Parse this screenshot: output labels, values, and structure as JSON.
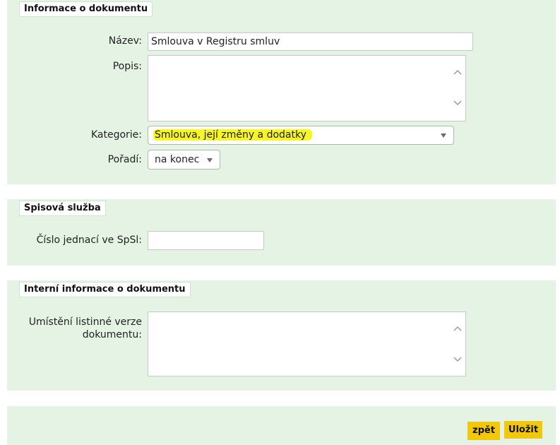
{
  "sections": {
    "document_info": {
      "title": "Informace o dokumentu",
      "name_label": "Název:",
      "name_value": "Smlouva v Registru smluv",
      "description_label": "Popis:",
      "description_value": "",
      "category_label": "Kategorie:",
      "category_value": "Smlouva, její změny a dodatky",
      "order_label": "Pořadí:",
      "order_value": "na konec"
    },
    "registry": {
      "title": "Spisová služba",
      "reference_label": "Číslo jednací ve SpSl:",
      "reference_value": ""
    },
    "internal_info": {
      "title": "Interní informace o dokumentu",
      "location_label_line1": "Umístění listinné verze",
      "location_label_line2": "dokumentu:",
      "location_value": ""
    }
  },
  "actions": {
    "back_label": "zpět",
    "save_label": "Uložit"
  },
  "colors": {
    "panel_background": "#e4f3e4",
    "button_background": "#f2c80f",
    "highlight": "#f7f52a"
  },
  "icons": {
    "scroll_up": "chevron-up-icon",
    "scroll_down": "chevron-down-icon",
    "dropdown": "caret-down-icon"
  }
}
